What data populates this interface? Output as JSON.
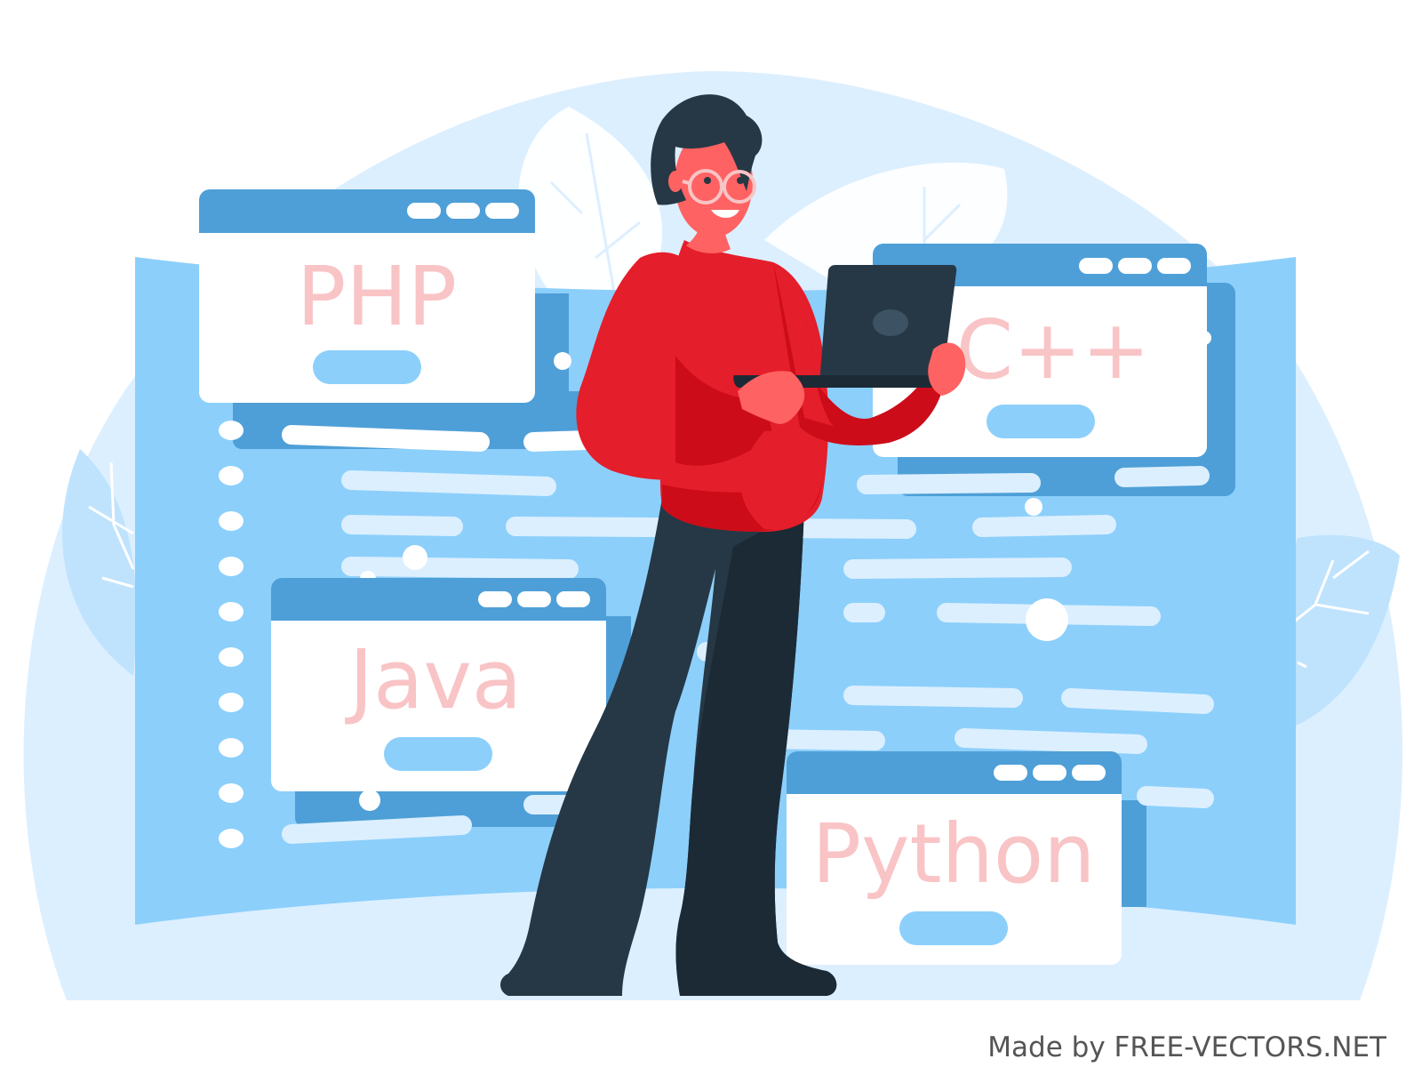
{
  "windows": {
    "php": {
      "label": "PHP"
    },
    "cpp": {
      "label": "C++"
    },
    "java": {
      "label": "Java"
    },
    "python": {
      "label": "Python"
    }
  },
  "credit": {
    "text": "Made by FREE-VECTORS.NET"
  },
  "colors": {
    "backdrop": "#dcefff",
    "panel": "#8ccffb",
    "window_bar": "#4e9fd7",
    "window_body": "#ffffff",
    "label_text": "#f9c4c6",
    "sweater": "#e41e2a",
    "pants": "#263845",
    "skin": "#ff6262",
    "laptop": "#263845"
  },
  "icons": [
    "leaf-icon",
    "laptop-icon",
    "glasses-icon"
  ]
}
